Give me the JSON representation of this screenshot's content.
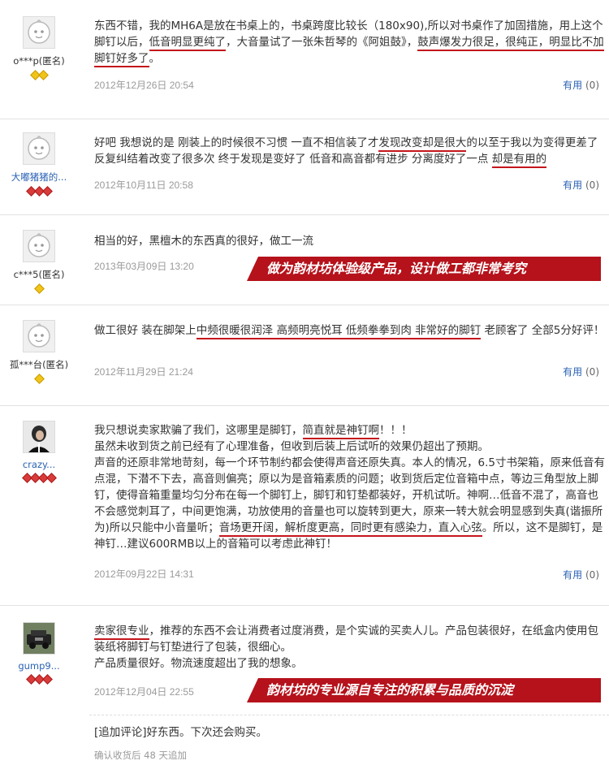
{
  "reviews": [
    {
      "user": "o***p(匿名)",
      "badges": "gold2",
      "avatar": "default-avatar",
      "text": [
        "东西不错，我的MH6A是放在书桌上的，书桌跨度比较长（180x90),所以对书桌作了加固措施，用上这个脚钉以后，",
        "低音明显更纯了",
        "，大音量试了一张朱哲琴的《阿姐鼓》，",
        "鼓声爆发力很足，很纯正，明显比不加脚钉好多了",
        "。"
      ],
      "date": "2012年12月26日 20:54",
      "useful_label": "有用",
      "useful_count": "(0)"
    },
    {
      "user": "大嘟猪猪的...",
      "badges": "red3",
      "avatar": "default-avatar",
      "text": [
        "好吧 我想说的是 刚装上的时候很不习惯 一直不相信装了才",
        "发现改变却是很大",
        "的以至于我以为变得更差了 反复纠结着改变了很多次 终于发现是变好了 低音和高音都有进步 分离度好了一点 ",
        "却是有用的",
        ""
      ],
      "date": "2012年10月11日 20:58",
      "useful_label": "有用",
      "useful_count": "(0)"
    },
    {
      "user": "c***5(匿名)",
      "badges": "gold1",
      "avatar": "default-avatar",
      "text": [
        "相当的好，黑檀木的东西真的很好，做工一流"
      ],
      "date": "2013年03月09日 13:20",
      "banner": "做为韵材坊体验级产品，设计做工都非常考究"
    },
    {
      "user": "孤***台(匿名)",
      "badges": "gold1",
      "avatar": "default-avatar",
      "text": [
        "做工很好 装在脚架上",
        "中频很暖很润泽 高频明亮悦耳 低频拳拳到肉 非常好的脚钉",
        " 老顾客了 全部5分好评！"
      ],
      "date": "2012年11月29日 21:24",
      "useful_label": "有用",
      "useful_count": "(0)"
    },
    {
      "user": "crazy...",
      "badges": "red4",
      "avatar": "photo-avatar",
      "paragraphs": [
        [
          "我只想说卖家欺骗了我们，这哪里是脚钉，",
          "简直就是神钉啊",
          "！！！"
        ],
        [
          "虽然未收到货之前已经有了心理准备，但收到后装上后试听的效果仍超出了预期。"
        ],
        [
          "声音的还原非常地苛刻，每一个环节制约都会使得声音还原失真。本人的情况，6.5寸书架箱，原来低音有点混，下潜不下去，高音则偏亮；原以为是音箱素质的问题；收到货后定位音箱中点，等边三角型放上脚钉，使得音箱重量均匀分布在每一个脚钉上，脚钉和钉垫都装好，开机试听。神啊…低音不混了，高音也不会感觉刺耳了，中间更饱满，功放使用的音量也可以旋转到更大，原来一转大就会明显感到失真(谐振所为)所以只能中小音量听；",
          "音场更开阔，解析度更高，同时更有感染力，直入心弦",
          "。所以，这不是脚钉，是神钉…建议600RMB以上的音箱可以考虑此神钉！"
        ]
      ],
      "date": "2012年09月22日 14:31",
      "useful_label": "有用",
      "useful_count": "(0)"
    },
    {
      "user": "gump9...",
      "badges": "red3",
      "avatar": "car-avatar",
      "paragraphs": [
        [
          "",
          "卖家很专业",
          "，推荐的东西不会让消费者过度消费，是个实诚的买卖人儿。产品包装很好，在纸盒内使用包装纸将脚钉与钉垫进行了包装，很细心。"
        ],
        [
          "产品质量很好。物流速度超出了我的想象。"
        ]
      ],
      "date": "2012年12月04日 22:55",
      "banner": "韵材坊的专业源自专注的积累与品质的沉淀",
      "append": "[追加评论]好东西。下次还会购买。",
      "confirm": "确认收货后 48 天追加"
    }
  ]
}
